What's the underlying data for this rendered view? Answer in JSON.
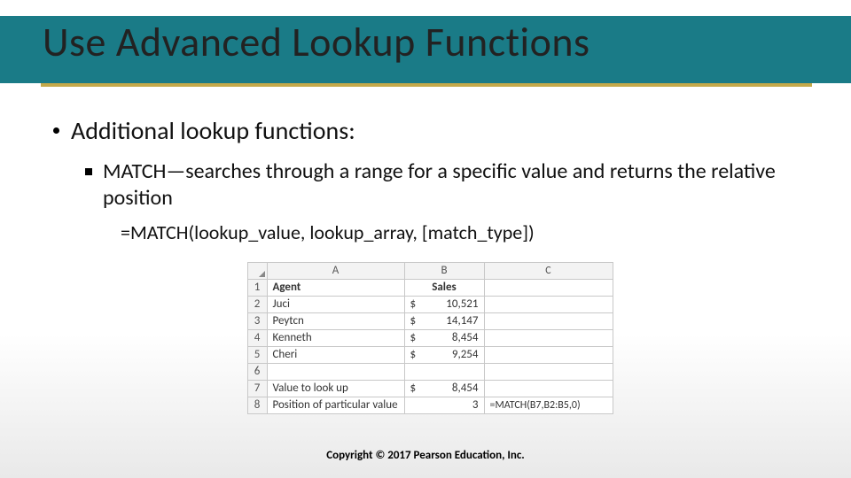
{
  "title": "Use Advanced Lookup Functions",
  "bullets": {
    "lvl1": "Additional lookup functions:",
    "lvl2": "MATCH—searches through a range for a specific value and returns the relative position",
    "lvl3": "=MATCH(lookup_value, lookup_array, [match_type])"
  },
  "sheet": {
    "cols": {
      "A": "A",
      "B": "B",
      "C": "C"
    },
    "rows": [
      {
        "n": "1",
        "A": "Agent",
        "A_bold": true,
        "B": "Sales",
        "B_header": true,
        "C": ""
      },
      {
        "n": "2",
        "A": "Juci",
        "B_cur": "$",
        "B_val": "10,521",
        "C": ""
      },
      {
        "n": "3",
        "A": "Peytcn",
        "B_cur": "$",
        "B_val": "14,147",
        "C": ""
      },
      {
        "n": "4",
        "A": "Kenneth",
        "B_cur": "$",
        "B_val": "8,454",
        "C": ""
      },
      {
        "n": "5",
        "A": "Cheri",
        "B_cur": "$",
        "B_val": "9,254",
        "C": ""
      },
      {
        "n": "6",
        "A": "",
        "B": "",
        "C": ""
      },
      {
        "n": "7",
        "A": "Value to look up",
        "B_cur": "$",
        "B_val": "8,454",
        "C": ""
      },
      {
        "n": "8",
        "A": "Position of particular value",
        "B_val": "3",
        "C": "=MATCH(B7,B2:B5,0)"
      }
    ]
  },
  "footer": "Copyright © 2017 Pearson Education, Inc."
}
